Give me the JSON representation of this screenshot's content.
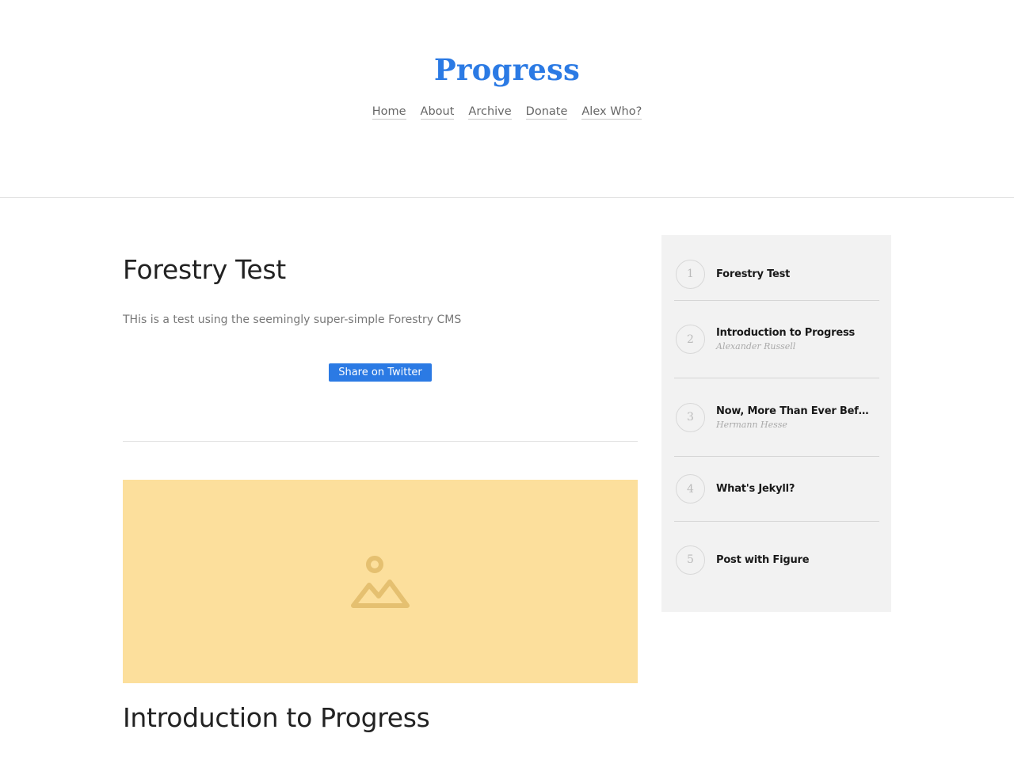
{
  "site": {
    "title": "Progress"
  },
  "nav": [
    "Home",
    "About",
    "Archive",
    "Donate",
    "Alex Who?"
  ],
  "post": {
    "title": "Forestry Test",
    "excerpt": "THis is a test using the seemingly super-simple Forestry CMS",
    "share_label": "Share on Twitter"
  },
  "next_post": {
    "title": "Introduction to Progress",
    "image_icon": "mountain-image-icon"
  },
  "sidebar": {
    "items": [
      {
        "num": "1",
        "title": "Forestry Test",
        "author": ""
      },
      {
        "num": "2",
        "title": "Introduction to Progress",
        "author": "Alexander Russell"
      },
      {
        "num": "3",
        "title": "Now, More Than Ever Before...",
        "author": "Hermann Hesse"
      },
      {
        "num": "4",
        "title": "What's Jekyll?",
        "author": ""
      },
      {
        "num": "5",
        "title": "Post with Figure",
        "author": ""
      }
    ]
  },
  "colors": {
    "accent": "#2b7ae4",
    "hero_bg": "#fcdf9c",
    "hero_icon": "#e5c070",
    "sidebar_bg": "#f2f2f2"
  }
}
